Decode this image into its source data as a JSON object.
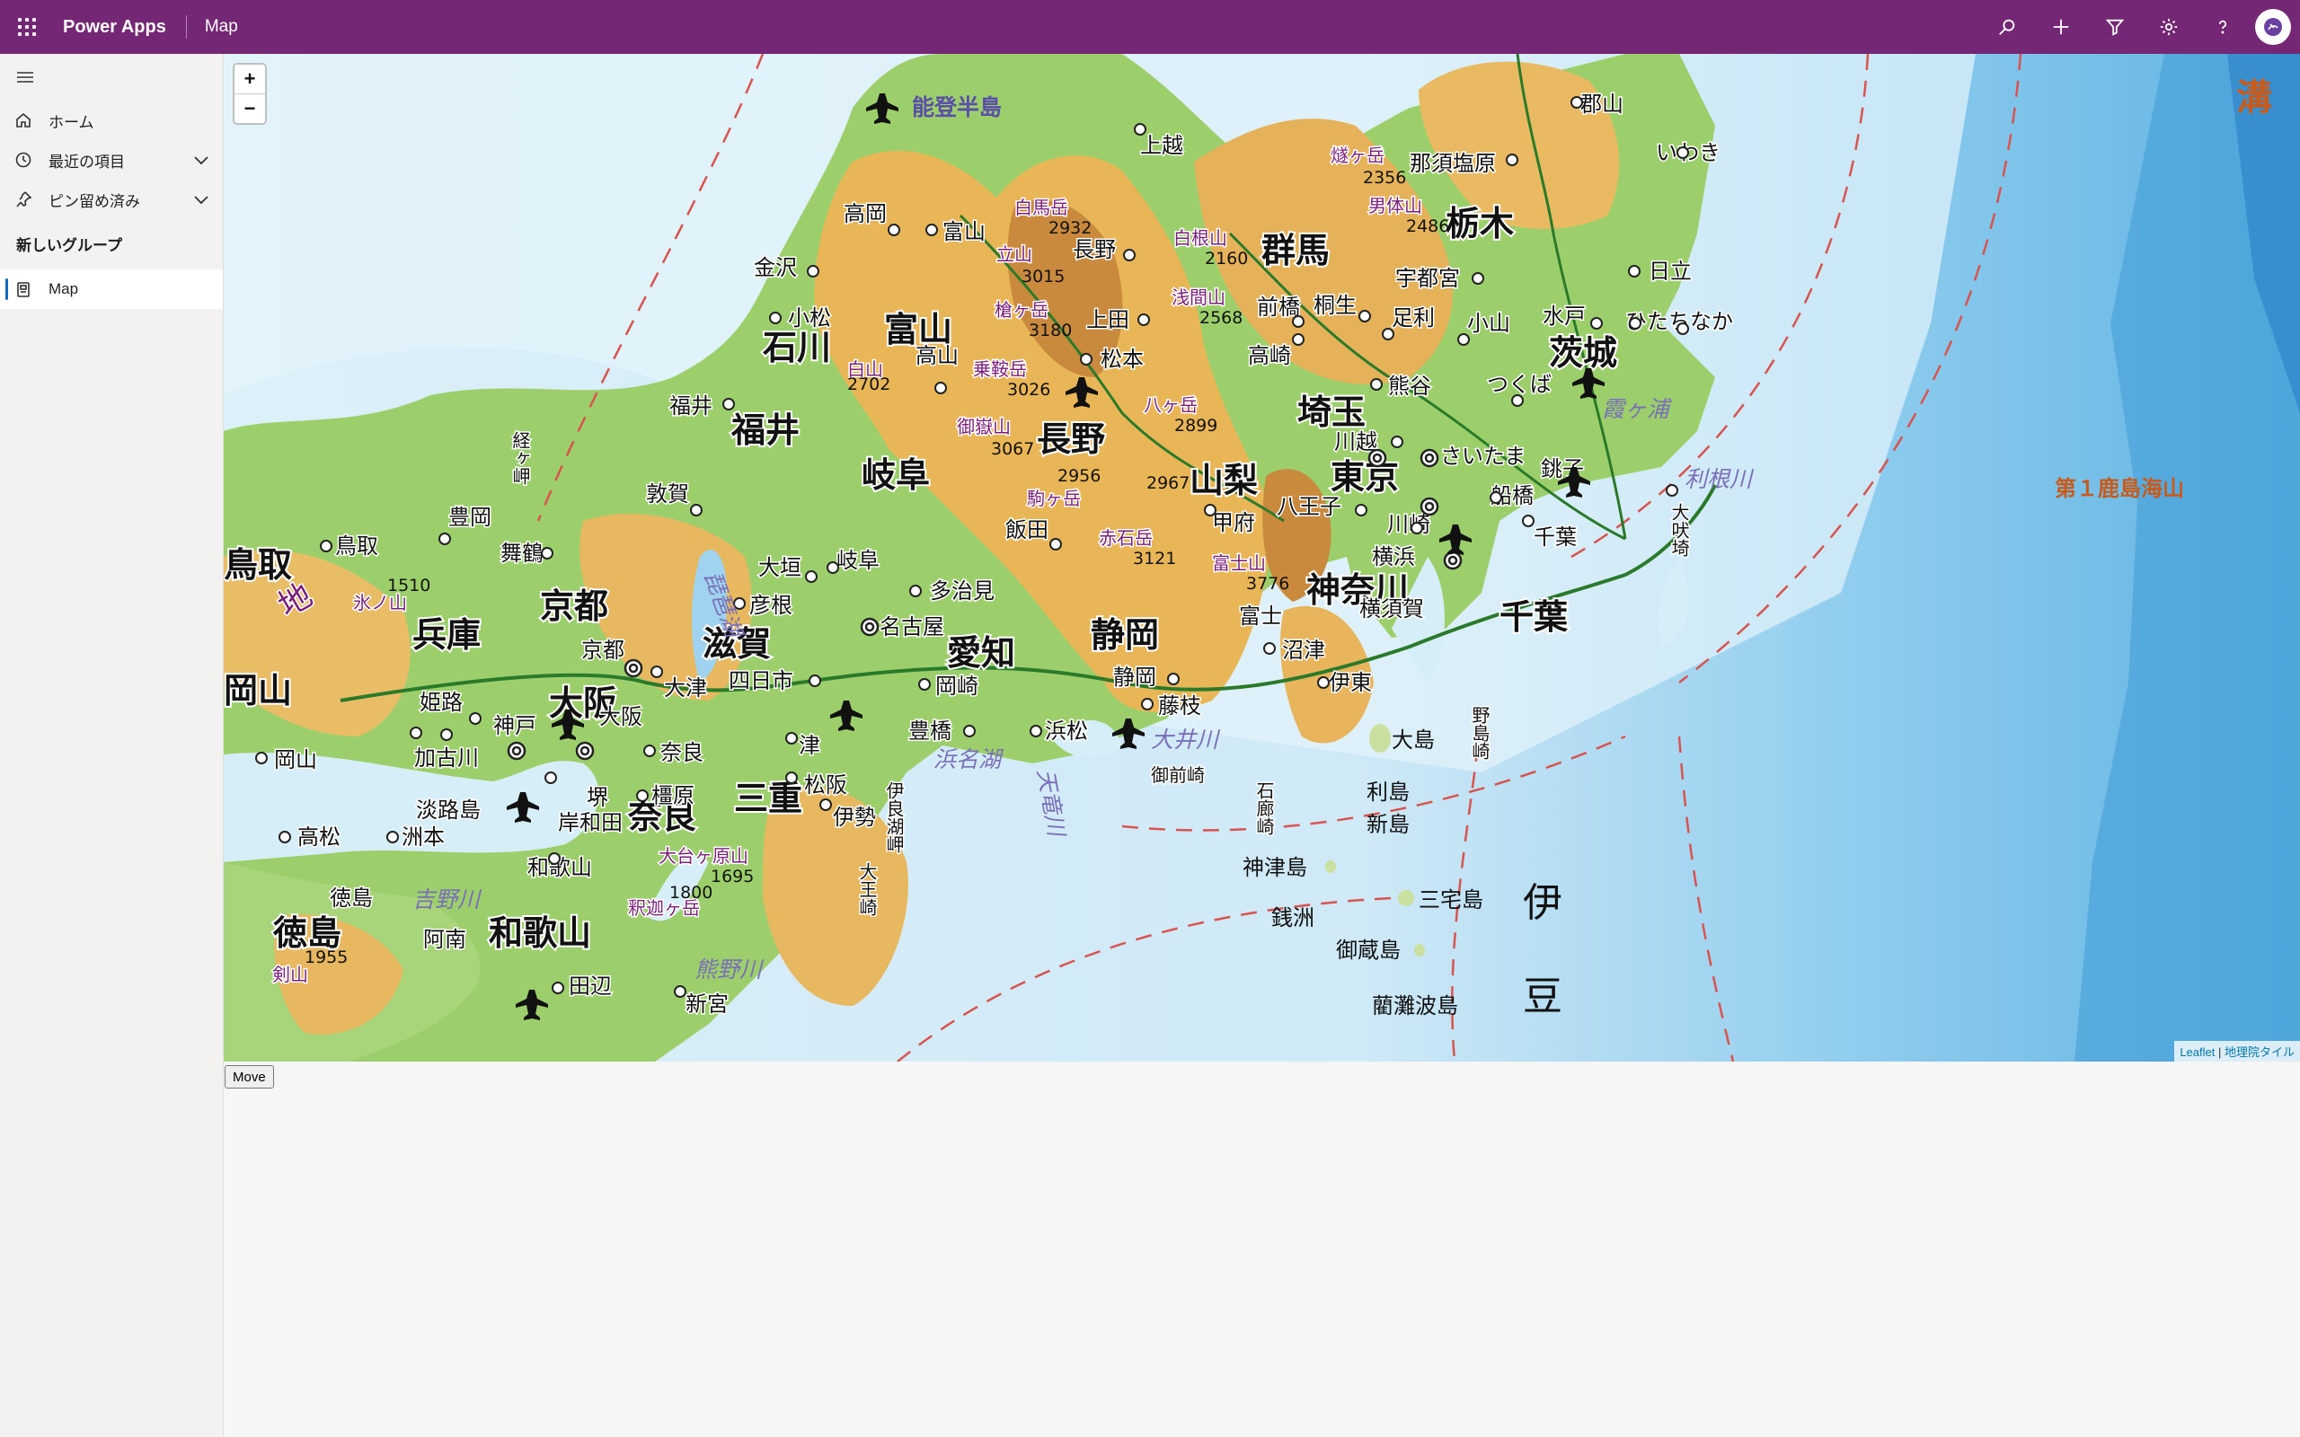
{
  "app": {
    "brand": "Power Apps",
    "title": "Map"
  },
  "topbar": {
    "icons": [
      "search-icon",
      "plus-icon",
      "filter-icon",
      "settings-icon",
      "help-icon"
    ],
    "accent": "#742774"
  },
  "sidebar": {
    "items": [
      {
        "label": "ホーム",
        "icon": "home-icon"
      },
      {
        "label": "最近の項目",
        "icon": "clock-icon"
      },
      {
        "label": "ピン留め済み",
        "icon": "pin-icon"
      }
    ],
    "group_title": "新しいグループ",
    "group_items": [
      {
        "label": "Map",
        "icon": "page-icon"
      }
    ]
  },
  "map": {
    "zoom_in": "+",
    "zoom_out": "−",
    "attribution": {
      "leaflet": "Leaflet",
      "sep": " | ",
      "provider": "地理院タイル"
    },
    "prefectures": [
      "富山",
      "石川",
      "福井",
      "岐阜",
      "長野",
      "群馬",
      "栃木",
      "茨城",
      "埼玉",
      "山梨",
      "東京",
      "神奈川",
      "千葉",
      "静岡",
      "愛知",
      "滋賀",
      "京都",
      "兵庫",
      "大阪",
      "奈良",
      "三重",
      "和歌山",
      "徳島",
      "鳥取",
      "岡山"
    ],
    "cities": [
      "高岡",
      "富山",
      "金沢",
      "小松",
      "福井",
      "敦賀",
      "上越",
      "長野",
      "松本",
      "上田",
      "高山",
      "飯田",
      "前橋",
      "桐生",
      "高崎",
      "宇都宮",
      "足利",
      "小山",
      "水戸",
      "ひたちなか",
      "日立",
      "いわき",
      "郡山",
      "熊谷",
      "つくば",
      "川越",
      "さいたま",
      "八王子",
      "甲府",
      "横浜",
      "川崎",
      "横須賀",
      "船橋",
      "千葉",
      "銚子",
      "富士",
      "沼津",
      "伊東",
      "静岡",
      "藤枝",
      "浜松",
      "豊橋",
      "岡崎",
      "名古屋",
      "多治見",
      "岐阜",
      "大垣",
      "彦根",
      "四日市",
      "津",
      "松阪",
      "伊勢",
      "奈良",
      "橿原",
      "大津",
      "京都",
      "神戸",
      "大阪",
      "堺",
      "岸和田",
      "和歌山",
      "田辺",
      "新宮",
      "姫路",
      "加古川",
      "岡山",
      "高松",
      "徳島",
      "阿南",
      "洲本",
      "豊岡",
      "舞鶴",
      "鳥取",
      "那須塩原"
    ],
    "mountains": [
      "白馬岳",
      "立山",
      "槍ヶ岳",
      "乗鞍岳",
      "御嶽山",
      "白山",
      "駒ヶ岳",
      "赤石岳",
      "八ヶ岳",
      "浅間山",
      "白根山",
      "燧ヶ岳",
      "男体山",
      "富士山",
      "大台ヶ原山",
      "釈迦ヶ岳",
      "氷ノ山",
      "剣山"
    ],
    "elevations": [
      "2932",
      "3015",
      "3180",
      "3026",
      "3067",
      "2702",
      "2956",
      "2967",
      "3121",
      "2899",
      "2568",
      "2160",
      "2356",
      "2486",
      "3776",
      "1510",
      "1695",
      "1800",
      "1955"
    ],
    "water": [
      "能登半島",
      "琵琶湖",
      "浜名湖",
      "大井川",
      "天竜川",
      "吉野川",
      "熊野川",
      "利根川",
      "霞ヶ浦",
      "淡路島"
    ],
    "capes": [
      "経ヶ岬",
      "御前崎",
      "石廊崎",
      "大王崎",
      "伊良湖岬",
      "野島崎",
      "大吠埼"
    ],
    "islands": [
      "大島",
      "利島",
      "新島",
      "神津島",
      "三宅島",
      "御蔵島",
      "銭洲",
      "藺灘波島"
    ],
    "regions": [
      "伊",
      "豆",
      "溝",
      "地",
      "第１鹿島海山"
    ]
  },
  "move_button": "Move"
}
